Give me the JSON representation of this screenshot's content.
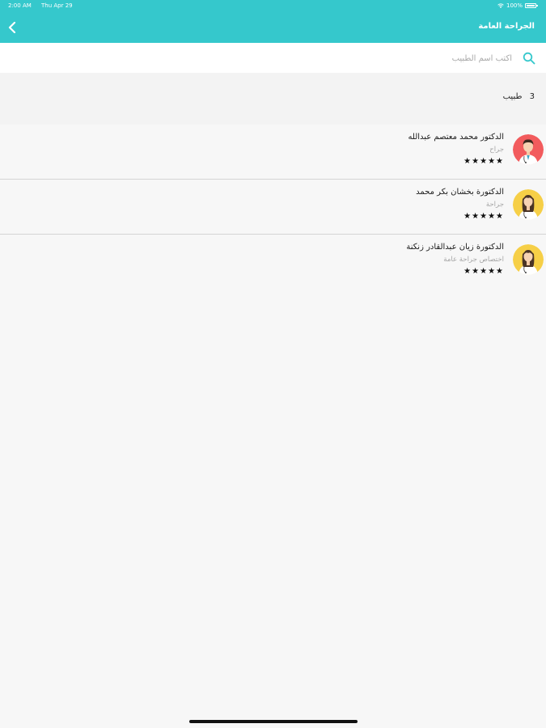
{
  "status_bar": {
    "time": "2:00 AM",
    "date": "Thu Apr 29",
    "battery": "100%"
  },
  "header": {
    "title": "الجراحة العامة",
    "background_color": "#35c8cc"
  },
  "search": {
    "placeholder": "اكتب اسم الطبيب",
    "value": ""
  },
  "summary": {
    "count": "3",
    "label": "طبيب"
  },
  "doctors": [
    {
      "name": "الدكتور محمد معتصم عبدالله",
      "specialty": "جراح",
      "rating": "★★★★★",
      "avatar": "male-doctor-avatar",
      "avatar_color": "#f25b5d"
    },
    {
      "name": "الدكتورة بخشان بكر محمد",
      "specialty": "جراحة",
      "rating": "★★★★★",
      "avatar": "female-doctor-avatar",
      "avatar_color": "#f6cf47"
    },
    {
      "name": "الدكتورة زيان عبدالقادر زنكنة",
      "specialty": "اختصاص جراحة عامة",
      "rating": "★★★★★",
      "avatar": "female-doctor-avatar",
      "avatar_color": "#f6cf47"
    }
  ]
}
